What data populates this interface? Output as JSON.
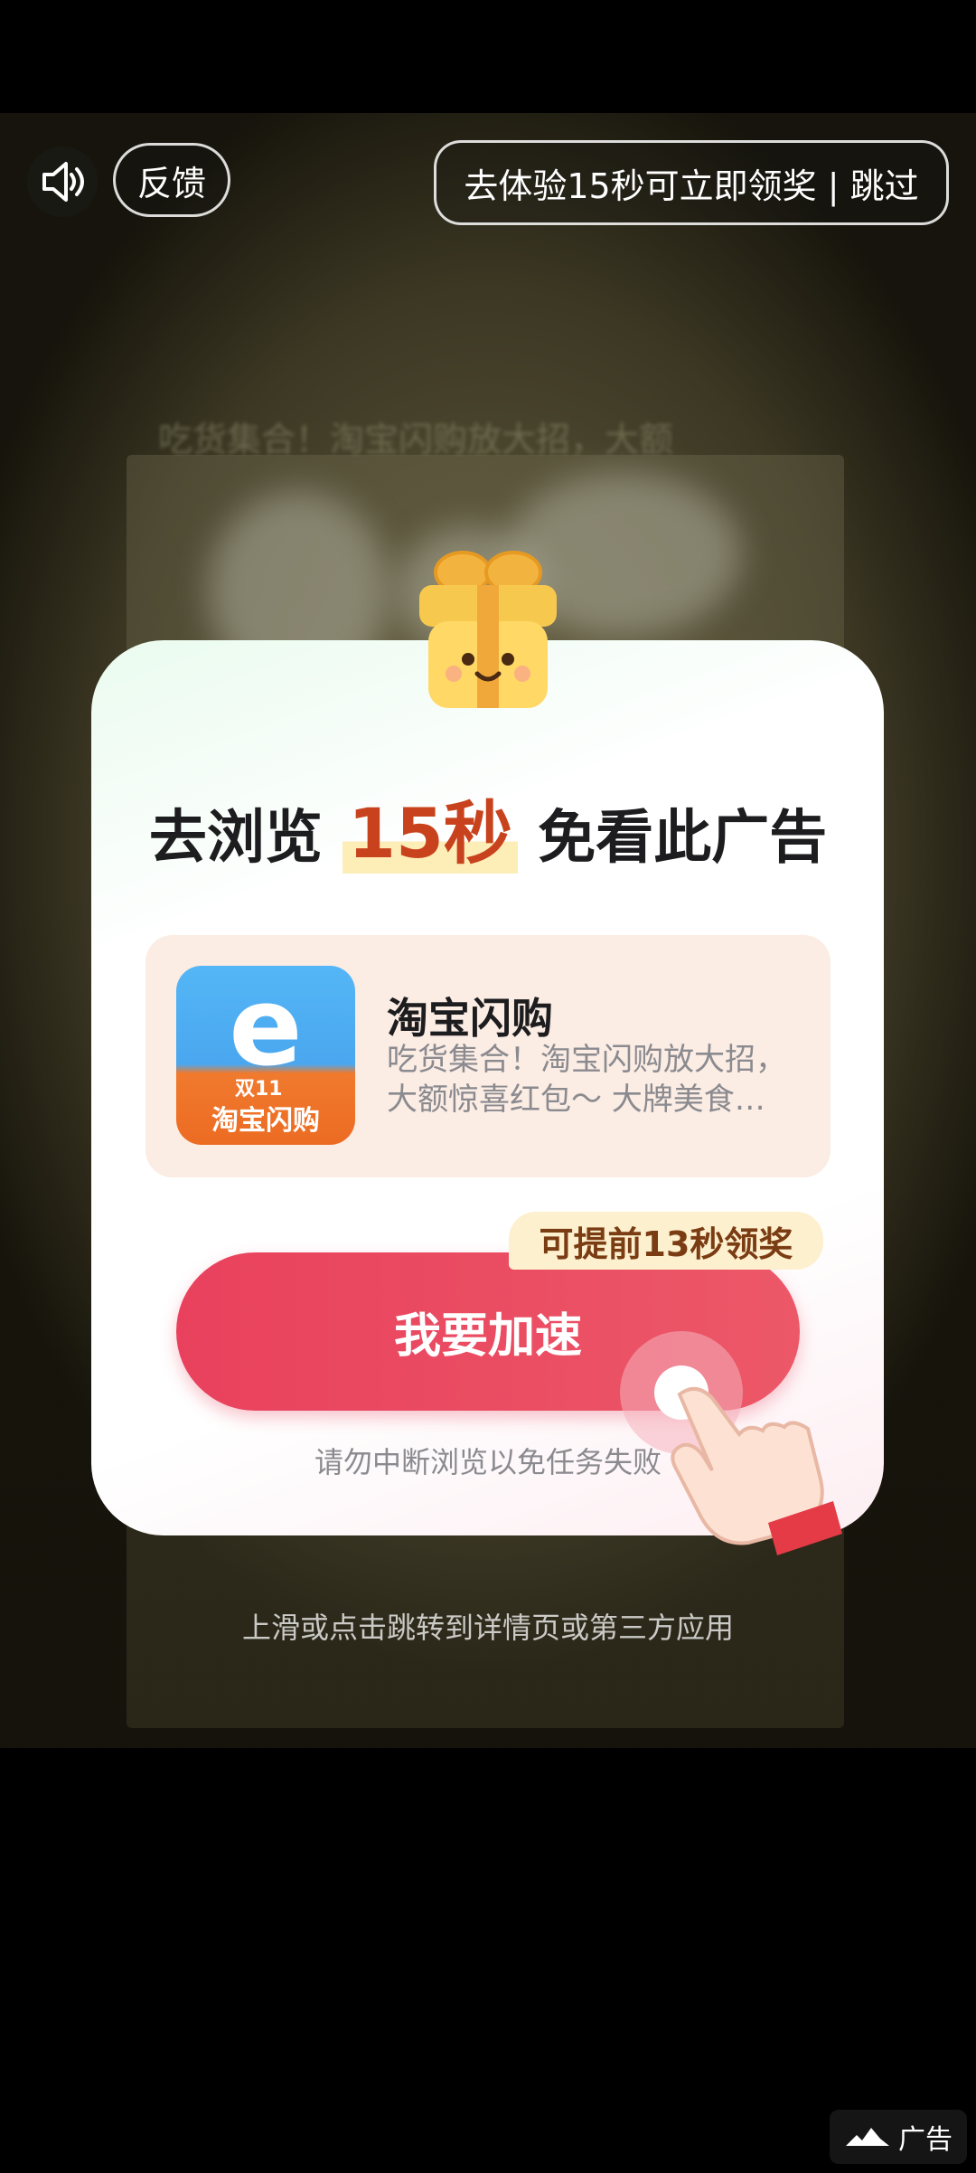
{
  "top_bar": {
    "sound_icon": "speaker-volume-icon",
    "feedback_label": "反馈",
    "skip_label": "去体验15秒可立即领奖 | 跳过"
  },
  "video": {
    "caption": "吃货集合！淘宝闪购放大招，大额"
  },
  "modal": {
    "gift_icon": "gift-box-icon",
    "title_prefix": "去浏览",
    "title_highlight": "15秒",
    "title_suffix": "免看此广告",
    "app": {
      "icon": "taobao-shangou-app-icon",
      "icon_tag": "双11",
      "icon_brand": "淘宝闪购",
      "name": "淘宝闪购",
      "description": "吃货集合！淘宝闪购放大招，大额惊喜红包～ 大牌美食…"
    },
    "speed_badge": "可提前13秒领奖",
    "speed_button": "我要加速",
    "hint": "请勿中断浏览以免任务失败",
    "hand_icon": "tap-hand-icon"
  },
  "swipe_hint": "上滑或点击跳转到详情页或第三方应用",
  "ad_badge": {
    "icon": "ad-logo-icon",
    "label": "广告"
  },
  "colors": {
    "accent": "#e9415d",
    "highlight": "#c8431d",
    "card_bg": "#fbece4",
    "badge_bg": "#fdf0cf"
  }
}
